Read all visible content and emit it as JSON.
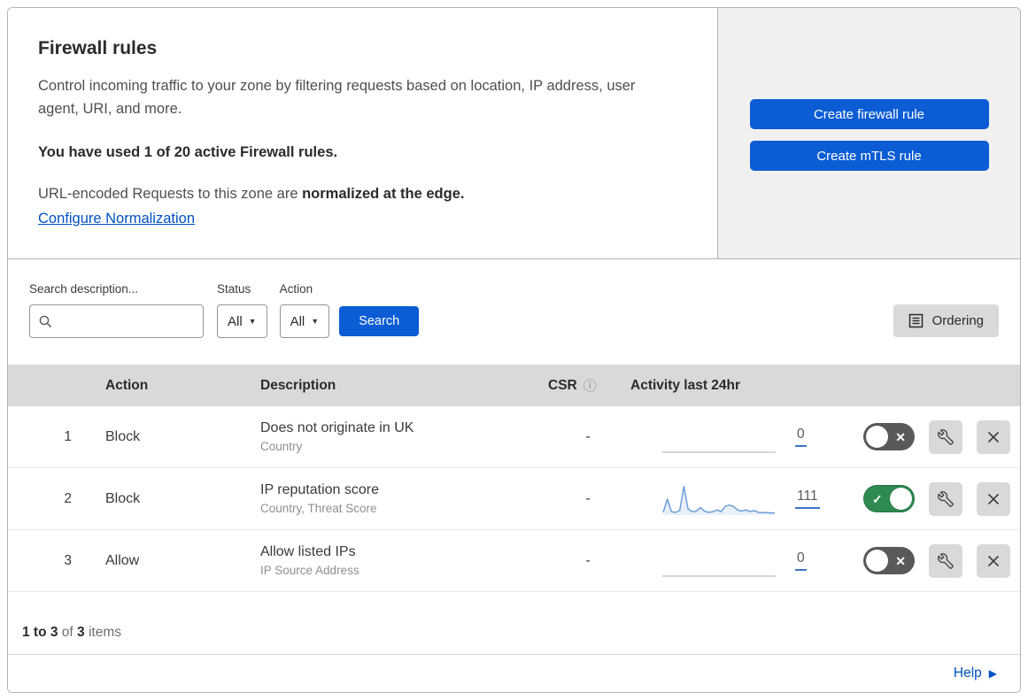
{
  "colors": {
    "accent_blue": "#0b5cd5",
    "link_blue": "#0051c3",
    "toggle_on_green": "#2d8a50",
    "toggle_off_gray": "#595959",
    "sparkline_blue": "#6f9ed9",
    "sparkline_fill": "#e9f0fa",
    "flat_line_gray": "#bdbdbd",
    "count_underline": "#3b74c9"
  },
  "intro": {
    "title": "Firewall rules",
    "description": "Control incoming traffic to your zone by filtering requests based on location, IP address, user agent, URI, and more.",
    "usage": "You have used 1 of 20 active Firewall rules.",
    "normalization_prefix": "URL-encoded Requests to this zone are ",
    "normalization_bold": "normalized at the edge.",
    "normalization_link": "Configure Normalization"
  },
  "actions_panel": {
    "create_firewall_label": "Create firewall rule",
    "create_mtls_label": "Create mTLS rule"
  },
  "filters": {
    "search_label": "Search description...",
    "search_value": "",
    "status_label": "Status",
    "status_value": "All",
    "action_label": "Action",
    "action_value": "All",
    "search_button": "Search",
    "ordering_button": "Ordering"
  },
  "table": {
    "headers": {
      "action": "Action",
      "description": "Description",
      "csr": "CSR",
      "csr_info_icon": "ⓘ",
      "activity": "Activity last 24hr"
    },
    "rows": [
      {
        "num": "1",
        "action": "Block",
        "description": "Does not originate in UK",
        "fields": "Country",
        "csr": "-",
        "activity_count": "0",
        "enabled": false,
        "sparkline": []
      },
      {
        "num": "2",
        "action": "Block",
        "description": "IP reputation score",
        "fields": "Country, Threat Score",
        "csr": "-",
        "activity_count": "111",
        "enabled": true,
        "sparkline": [
          6,
          50,
          8,
          6,
          12,
          92,
          18,
          8,
          10,
          22,
          10,
          6,
          8,
          14,
          8,
          26,
          30,
          26,
          14,
          10,
          14,
          9,
          12,
          6,
          5,
          5,
          4,
          4
        ]
      },
      {
        "num": "3",
        "action": "Allow",
        "description": "Allow listed IPs",
        "fields": "IP Source Address",
        "csr": "-",
        "activity_count": "0",
        "enabled": false,
        "sparkline": []
      }
    ]
  },
  "footer": {
    "range": "1 to 3",
    "of_text": " of ",
    "total": "3",
    "items_text": " items",
    "help": "Help",
    "help_arrow": "▶"
  },
  "glyphs": {
    "dropdown_arrow": "▼",
    "toggle_check": "✓",
    "toggle_cross": "✕"
  }
}
